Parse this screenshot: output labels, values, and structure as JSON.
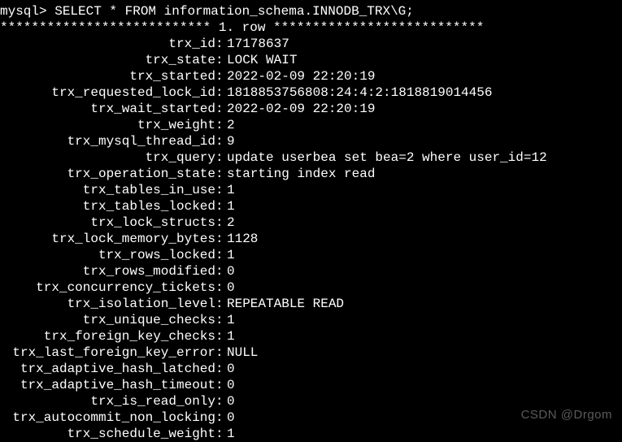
{
  "prompt": "mysql> SELECT * FROM information_schema.INNODB_TRX\\G;",
  "separator": "*************************** 1. row ***************************",
  "fields": [
    {
      "label": "trx_id",
      "value": "17178637"
    },
    {
      "label": "trx_state",
      "value": "LOCK WAIT"
    },
    {
      "label": "trx_started",
      "value": "2022-02-09 22:20:19"
    },
    {
      "label": "trx_requested_lock_id",
      "value": "1818853756808:24:4:2:1818819014456"
    },
    {
      "label": "trx_wait_started",
      "value": "2022-02-09 22:20:19"
    },
    {
      "label": "trx_weight",
      "value": "2"
    },
    {
      "label": "trx_mysql_thread_id",
      "value": "9"
    },
    {
      "label": "trx_query",
      "value": "update userbea set bea=2 where user_id=12"
    },
    {
      "label": "trx_operation_state",
      "value": "starting index read"
    },
    {
      "label": "trx_tables_in_use",
      "value": "1"
    },
    {
      "label": "trx_tables_locked",
      "value": "1"
    },
    {
      "label": "trx_lock_structs",
      "value": "2"
    },
    {
      "label": "trx_lock_memory_bytes",
      "value": "1128"
    },
    {
      "label": "trx_rows_locked",
      "value": "1"
    },
    {
      "label": "trx_rows_modified",
      "value": "0"
    },
    {
      "label": "trx_concurrency_tickets",
      "value": "0"
    },
    {
      "label": "trx_isolation_level",
      "value": "REPEATABLE READ"
    },
    {
      "label": "trx_unique_checks",
      "value": "1"
    },
    {
      "label": "trx_foreign_key_checks",
      "value": "1"
    },
    {
      "label": "trx_last_foreign_key_error",
      "value": "NULL"
    },
    {
      "label": "trx_adaptive_hash_latched",
      "value": "0"
    },
    {
      "label": "trx_adaptive_hash_timeout",
      "value": "0"
    },
    {
      "label": "trx_is_read_only",
      "value": "0"
    },
    {
      "label": "trx_autocommit_non_locking",
      "value": "0"
    },
    {
      "label": "trx_schedule_weight",
      "value": "1"
    }
  ],
  "watermark": "CSDN @Drgom"
}
